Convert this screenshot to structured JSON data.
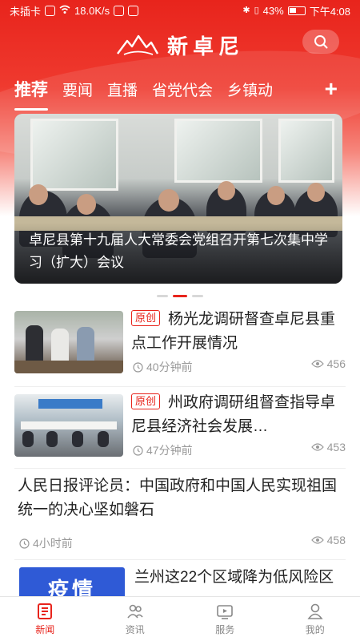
{
  "status_bar": {
    "carrier": "未插卡",
    "speed": "18.0K/s",
    "battery": "43%",
    "time": "下午4:08"
  },
  "app": {
    "title": "新卓尼",
    "colors": {
      "primary": "#e8241c",
      "badge_blue": "#2f5ad6"
    }
  },
  "tabs": [
    {
      "label": "推荐",
      "active": true
    },
    {
      "label": "要闻"
    },
    {
      "label": "直播"
    },
    {
      "label": "省党代会"
    },
    {
      "label": "乡镇动"
    }
  ],
  "tab_add_label": "+",
  "carousel": {
    "caption": "卓尼县第十九届人大常委会党组召开第七次集中学习（扩大）会议",
    "slide_count": 3,
    "active_slide": 2
  },
  "news": [
    {
      "tag": "原创",
      "title": "杨光龙调研督查卓尼县重点工作开展情况",
      "time": "40分钟前",
      "views": "456"
    },
    {
      "tag": "原创",
      "title": "州政府调研组督查指导卓尼县经济社会发展…",
      "time": "47分钟前",
      "views": "453"
    },
    {
      "title": "人民日报评论员：中国政府和中国人民实现祖国统一的决心坚如磐石",
      "time": "4小时前",
      "views": "458"
    },
    {
      "badge": "疫情",
      "title": "兰州这22个区域降为低风险区"
    }
  ],
  "bottom_nav": [
    {
      "label": "新闻",
      "icon": "news-icon",
      "active": true
    },
    {
      "label": "资讯",
      "icon": "people-icon"
    },
    {
      "label": "服务",
      "icon": "tv-icon"
    },
    {
      "label": "我的",
      "icon": "user-icon"
    }
  ]
}
